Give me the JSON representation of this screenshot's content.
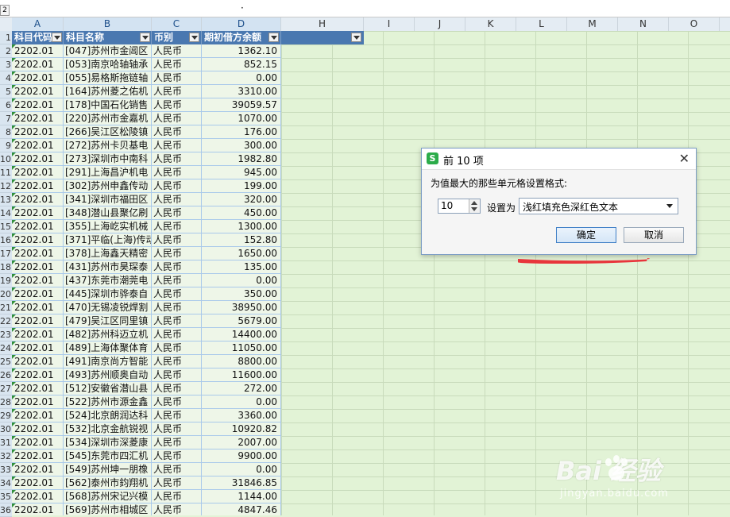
{
  "formula_bar": {
    "outline_level": "2",
    "marker": "·"
  },
  "columns": [
    {
      "letter": "A",
      "selected": true
    },
    {
      "letter": "B",
      "selected": true
    },
    {
      "letter": "C",
      "selected": true
    },
    {
      "letter": "D",
      "selected": true
    },
    {
      "letter": "H",
      "selected": false
    },
    {
      "letter": "I",
      "selected": false
    },
    {
      "letter": "J",
      "selected": false
    },
    {
      "letter": "K",
      "selected": false
    },
    {
      "letter": "L",
      "selected": false
    },
    {
      "letter": "M",
      "selected": false
    },
    {
      "letter": "N",
      "selected": false
    },
    {
      "letter": "O",
      "selected": false
    }
  ],
  "row_numbers": [
    "1",
    "2",
    "3",
    "4",
    "5",
    "6",
    "7",
    "8",
    "9",
    "10",
    "11",
    "12",
    "13",
    "14",
    "15",
    "16",
    "17",
    "18",
    "19",
    "20",
    "21",
    "22",
    "23",
    "24",
    "25",
    "26",
    "27",
    "28",
    "29",
    "30",
    "31",
    "32",
    "33",
    "34",
    "35",
    "36"
  ],
  "table": {
    "headers": [
      "科目代码",
      "科目名称",
      "币别",
      "期初借方余额"
    ],
    "rows": [
      [
        "2202.01",
        "[047]苏州市金阊区",
        "人民币",
        "1362.10"
      ],
      [
        "2202.01",
        "[053]南京哈轴轴承",
        "人民币",
        "852.15"
      ],
      [
        "2202.01",
        "[055]易格斯拖链轴",
        "人民币",
        "0.00"
      ],
      [
        "2202.01",
        "[164]苏州菱之佑机",
        "人民币",
        "3310.00"
      ],
      [
        "2202.01",
        "[178]中国石化销售",
        "人民币",
        "39059.57"
      ],
      [
        "2202.01",
        "[220]苏州市金嘉机",
        "人民币",
        "1070.00"
      ],
      [
        "2202.01",
        "[266]吴江区松陵镇",
        "人民币",
        "176.00"
      ],
      [
        "2202.01",
        "[272]苏州卡贝基电",
        "人民币",
        "300.00"
      ],
      [
        "2202.01",
        "[273]深圳市中南科",
        "人民币",
        "1982.80"
      ],
      [
        "2202.01",
        "[291]上海昌沪机电",
        "人民币",
        "945.00"
      ],
      [
        "2202.01",
        "[302]苏州申鑫传动",
        "人民币",
        "199.00"
      ],
      [
        "2202.01",
        "[341]深圳市福田区",
        "人民币",
        "320.00"
      ],
      [
        "2202.01",
        "[348]潜山县聚亿刷",
        "人民币",
        "450.00"
      ],
      [
        "2202.01",
        "[355]上海屹实机械",
        "人民币",
        "1300.00"
      ],
      [
        "2202.01",
        "[371]平临(上海)传动",
        "人民币",
        "152.80"
      ],
      [
        "2202.01",
        "[378]上海鑫天精密",
        "人民币",
        "1650.00"
      ],
      [
        "2202.01",
        "[431]苏州市昊琛泰",
        "人民币",
        "135.00"
      ],
      [
        "2202.01",
        "[437]东莞市潮莞电",
        "人民币",
        "0.00"
      ],
      [
        "2202.01",
        "[445]深圳市骅泰自",
        "人民币",
        "350.00"
      ],
      [
        "2202.01",
        "[470]无锡凌锐焊割",
        "人民币",
        "38950.00"
      ],
      [
        "2202.01",
        "[479]吴江区同里镇",
        "人民币",
        "5679.00"
      ],
      [
        "2202.01",
        "[482]苏州科迈立机",
        "人民币",
        "14400.00"
      ],
      [
        "2202.01",
        "[489]上海体聚体育",
        "人民币",
        "11050.00"
      ],
      [
        "2202.01",
        "[491]南京尚方智能",
        "人民币",
        "8800.00"
      ],
      [
        "2202.01",
        "[493]苏州顺奥自动",
        "人民币",
        "11600.00"
      ],
      [
        "2202.01",
        "[512]安徽省潜山县",
        "人民币",
        "272.00"
      ],
      [
        "2202.01",
        "[522]苏州市源金鑫",
        "人民币",
        "0.00"
      ],
      [
        "2202.01",
        "[524]北京朗润达科",
        "人民币",
        "3360.00"
      ],
      [
        "2202.01",
        "[532]北京金航锐视",
        "人民币",
        "10920.82"
      ],
      [
        "2202.01",
        "[534]深圳市深菱康",
        "人民币",
        "2007.00"
      ],
      [
        "2202.01",
        "[545]东莞市四汇机",
        "人民币",
        "9900.00"
      ],
      [
        "2202.01",
        "[549]苏州坤一朋橡",
        "人民币",
        "0.00"
      ],
      [
        "2202.01",
        "[562]泰州市鈞翔机",
        "人民币",
        "31846.85"
      ],
      [
        "2202.01",
        "[568]苏州宋记兴模",
        "人民币",
        "1144.00"
      ],
      [
        "2202.01",
        "[569]苏州市相城区",
        "人民币",
        "4847.46"
      ]
    ]
  },
  "dialog": {
    "title": "前 10 项",
    "message": "为值最大的那些单元格设置格式:",
    "count_value": "10",
    "set_as_label": "设置为",
    "format_value": "浅红填充色深红色文本",
    "ok_label": "确定",
    "cancel_label": "取消",
    "close_glyph": "✕",
    "logo_letter": "S"
  },
  "watermark": {
    "main": "Bai  经验",
    "sub": "jingyan.baidu.com"
  },
  "colors": {
    "header_bg": "#4a78b0",
    "grid_bg": "#e2f3d6",
    "accent_green": "#2cac4a",
    "mark_red": "#e8353b"
  }
}
